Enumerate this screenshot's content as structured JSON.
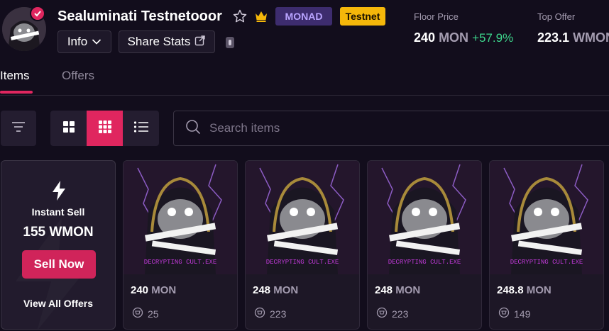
{
  "collection": {
    "title": "Sealuminati Testnetooor",
    "badges": {
      "monad": "MONAD",
      "testnet": "Testnet"
    },
    "info_label": "Info",
    "share_label": "Share Stats"
  },
  "stats": {
    "floor": {
      "label": "Floor Price",
      "value": "240",
      "unit": "MON",
      "change": "+57.9%"
    },
    "top_offer": {
      "label": "Top Offer",
      "value": "223.1",
      "unit": "WMON"
    }
  },
  "tabs": [
    {
      "label": "Items",
      "active": true
    },
    {
      "label": "Offers",
      "active": false
    }
  ],
  "search": {
    "placeholder": "Search items"
  },
  "instant_sell": {
    "label": "Instant Sell",
    "amount": "155 WMON",
    "button": "Sell Now",
    "view_all": "View All Offers"
  },
  "items": [
    {
      "price": "240",
      "unit": "MON",
      "count": "25",
      "image_text": "DECRYPTING CULT.EXE"
    },
    {
      "price": "248",
      "unit": "MON",
      "count": "223",
      "image_text": "DECRYPTING CULT.EXE"
    },
    {
      "price": "248",
      "unit": "MON",
      "count": "223",
      "image_text": "DECRYPTING CULT.EXE"
    },
    {
      "price": "248.8",
      "unit": "MON",
      "count": "149",
      "image_text": "DECRYPTING CULT.EXE"
    }
  ],
  "colors": {
    "accent": "#e0265f",
    "background": "#120d1c",
    "positive": "#3dd68c",
    "testnet": "#f5b70a",
    "monad": "#3d2c6e"
  },
  "icons": [
    "star-icon",
    "crown-icon",
    "chevron-down-icon",
    "share-icon",
    "copy-icon",
    "filter-icon",
    "grid-large-icon",
    "grid-small-icon",
    "list-icon",
    "search-icon",
    "bolt-icon",
    "sales-icon"
  ]
}
